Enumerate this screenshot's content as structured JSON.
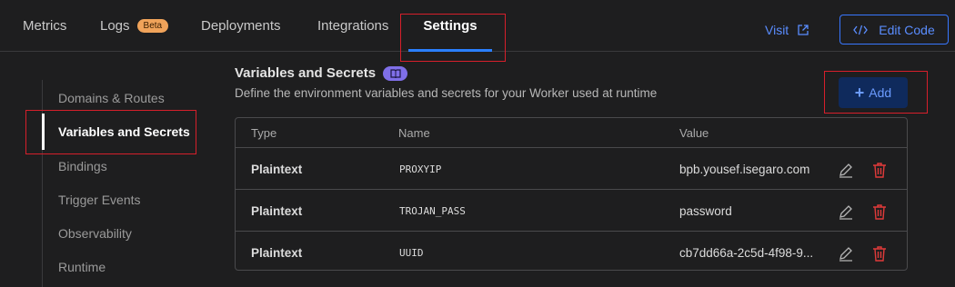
{
  "tabs": [
    {
      "label": "Metrics"
    },
    {
      "label": "Logs",
      "badge": "Beta"
    },
    {
      "label": "Deployments"
    },
    {
      "label": "Integrations"
    },
    {
      "label": "Settings",
      "active": true
    }
  ],
  "header_actions": {
    "visit_label": "Visit",
    "edit_code_label": "Edit Code"
  },
  "sidebar": {
    "items": [
      {
        "label": "Domains & Routes"
      },
      {
        "label": "Variables and Secrets",
        "active": true
      },
      {
        "label": "Bindings"
      },
      {
        "label": "Trigger Events"
      },
      {
        "label": "Observability"
      },
      {
        "label": "Runtime"
      }
    ]
  },
  "section": {
    "title": "Variables and Secrets",
    "description": "Define the environment variables and secrets for your Worker used at runtime",
    "add_label": "Add"
  },
  "table": {
    "columns": [
      "Type",
      "Name",
      "Value"
    ],
    "rows": [
      {
        "type": "Plaintext",
        "name": "PROXYIP",
        "value": "bpb.yousef.isegaro.com"
      },
      {
        "type": "Plaintext",
        "name": "TROJAN_PASS",
        "value": "password"
      },
      {
        "type": "Plaintext",
        "name": "UUID",
        "value": "cb7dd66a-2c5d-4f98-9..."
      }
    ]
  },
  "colors": {
    "accent": "#2b7fff",
    "highlight": "#d61f2b",
    "badge": "#f0a35a",
    "delete": "#e03a3a"
  }
}
